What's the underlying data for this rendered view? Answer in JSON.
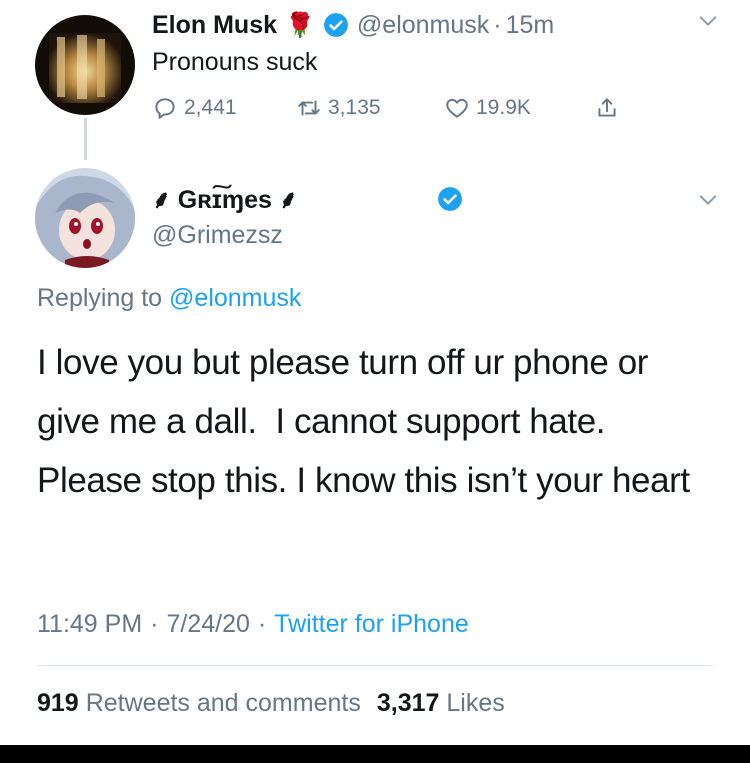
{
  "parent_tweet": {
    "author_name": "Elon Musk",
    "author_emoji": "🌹",
    "handle": "@elonmusk",
    "separator": "·",
    "time": "15m",
    "text": "Pronouns suck",
    "replies": "2,441",
    "retweets": "3,135",
    "likes": "19.9K"
  },
  "reply_tweet": {
    "author_name": "⸙ Gʀɪ͠ɱes ⸙",
    "handle": "@Grimezsz",
    "replying_prefix": "Replying to",
    "replying_handle": "@elonmusk",
    "text": "I love you but please turn off ur phone or give me a dall.  I cannot support hate.  Please stop this. I know this isn’t your heart",
    "time": "11:49 PM",
    "date": "7/24/20",
    "sep1": "·",
    "sep2": "·",
    "source": "Twitter for iPhone",
    "retweets_count": "919",
    "retweets_label": "Retweets and comments",
    "likes_count": "3,317",
    "likes_label": "Likes"
  },
  "colors": {
    "accent": "#1da1f2",
    "muted": "#657786",
    "text": "#14171a",
    "divider": "#e1e8ed"
  },
  "icons": [
    "reply-icon",
    "retweet-icon",
    "like-icon",
    "share-icon",
    "verified-badge-icon",
    "chevron-down-icon"
  ]
}
